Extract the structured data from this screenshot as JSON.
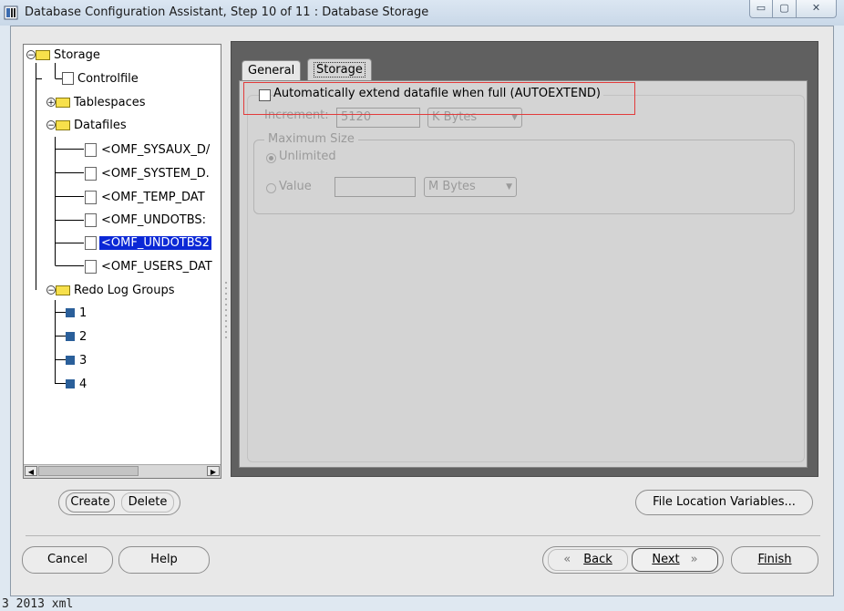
{
  "window": {
    "title": "Database Configuration Assistant, Step 10 of 11 : Database Storage",
    "controls": {
      "minimize": "▭",
      "maximize": "▢",
      "close": "✕"
    }
  },
  "tree": {
    "root": "Storage",
    "controlfile": "Controlfile",
    "tablespaces": "Tablespaces",
    "datafiles": "Datafiles",
    "datafile_items": [
      "<OMF_SYSAUX_D/",
      "<OMF_SYSTEM_D.",
      "<OMF_TEMP_DAT",
      "<OMF_UNDOTBS:",
      "<OMF_UNDOTBS2",
      "<OMF_USERS_DAT"
    ],
    "selected_index": 4,
    "redo": "Redo Log Groups",
    "redo_items": [
      "1",
      "2",
      "3",
      "4"
    ]
  },
  "tabs": [
    "General",
    "Storage"
  ],
  "active_tab": "Storage",
  "storage": {
    "autoextend_label": "Automatically extend datafile when full (AUTOEXTEND)",
    "increment_label": "Increment:",
    "increment_value": "5120",
    "increment_unit": "K Bytes",
    "max_size_legend": "Maximum Size",
    "unlimited_label": "Unlimited",
    "value_label": "Value",
    "value_value": "",
    "value_unit": "M Bytes"
  },
  "buttons": {
    "create": "Create",
    "delete": "Delete",
    "file_location": "File Location Variables...",
    "cancel": "Cancel",
    "help": "Help",
    "back": "Back",
    "next": "Next",
    "finish": "Finish"
  },
  "footer_text": "3 2013 xml",
  "colors": {
    "selection": "#0b28d6",
    "highlight_box": "#e23b3b"
  }
}
